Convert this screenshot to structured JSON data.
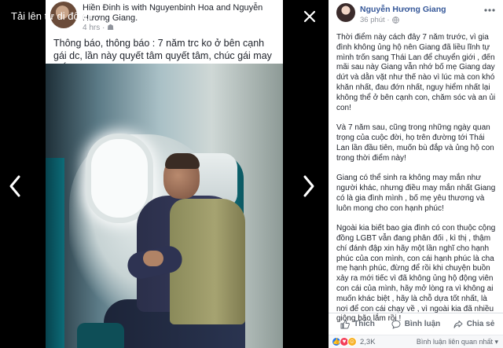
{
  "viewer": {
    "title": "Tải lên từ di động"
  },
  "photo_post": {
    "author_line": "Hiền Đinh is with Nguyenbinh Hoa and Nguyễn Hương Giang.",
    "time": "4 hrs · ",
    "text": "Thông báo, thông báo : 7 năm trc ko ở bên cạnh gái dc, lần này quyết tâm quyết tâm, chúc gái may mắn. Hết thông báo!"
  },
  "post": {
    "author": "Nguyễn Hương Giang",
    "time": "36 phút · ",
    "paragraphs": [
      "Thời điểm này cách đây 7 năm trước, vì gia đình không ủng hộ nên Giang đã liều lĩnh tự mình trốn sang Thái Lan để chuyển giới , đến mãi sau này Giang vẫn nhớ bố mẹ Giang day dứt và dằn vặt như thế nào vì lúc mà con khó khăn nhất, đau đớn nhất, nguy hiểm nhất lại không thể ở bên cạnh con, chăm sóc và an ủi con!",
      "Và 7 năm sau, cũng trong những ngày quan trọng của cuộc đời, họ trên đường tới Thái Lan lần đầu tiên, muốn bù đắp và ủng hộ con trong thời điểm này!",
      "Giang có thể sinh ra không may mắn như người khác, nhưng điều may mắn nhất Giang có là gia đình mình , bố mẹ yêu thương và luôn mong cho con hạnh phúc!",
      "Ngoài kia biết bao gia đình có con thuộc cộng đồng LGBT vẫn đang phân đối , kì thị , thậm chí đánh đập xin hãy một lần nghĩ cho hạnh phúc của con mình, con cái hạnh phúc là cha mẹ hạnh phúc, đừng để rồi khi chuyện buồn xảy ra mới tiếc vì đã không ủng hộ động viên con cái của mình, hãy mở lòng ra vì không ai muốn khác biệt , hãy là chỗ dựa tốt nhất, là nơi để con cái chạy về , vì ngoài kia đã nhiều giông bão lắm rồi !"
    ]
  },
  "actions": {
    "like": "Thích",
    "comment": "Bình luận",
    "share": "Chia sẻ"
  },
  "reactions": {
    "count": "2,3K",
    "comments_filter": "Bình luận liên quan nhất ▾"
  },
  "colors": {
    "link": "#365899",
    "like": "#2078f4",
    "love": "#f33e58",
    "haha": "#f7b125"
  },
  "icons": [
    "close-icon",
    "chevron-left-icon",
    "chevron-right-icon",
    "globe-icon",
    "more-icon",
    "like-icon",
    "comment-icon",
    "share-icon"
  ]
}
